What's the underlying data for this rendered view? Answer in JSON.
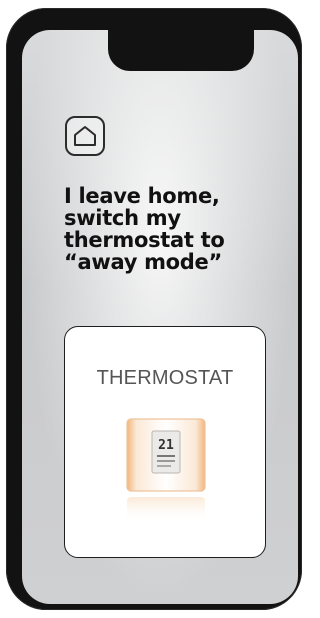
{
  "screen": {
    "headline": "I leave home,\nswitch my\nthermostat to\n“away mode”",
    "home_icon": "home-icon"
  },
  "card": {
    "title": "THERMOSTAT",
    "device_icon": "thermostat-device",
    "display_value": "21"
  },
  "colors": {
    "frame": "#121212",
    "screen_bg": "#d4d5d7",
    "text": "#111111",
    "accent": "#e8a96a"
  }
}
